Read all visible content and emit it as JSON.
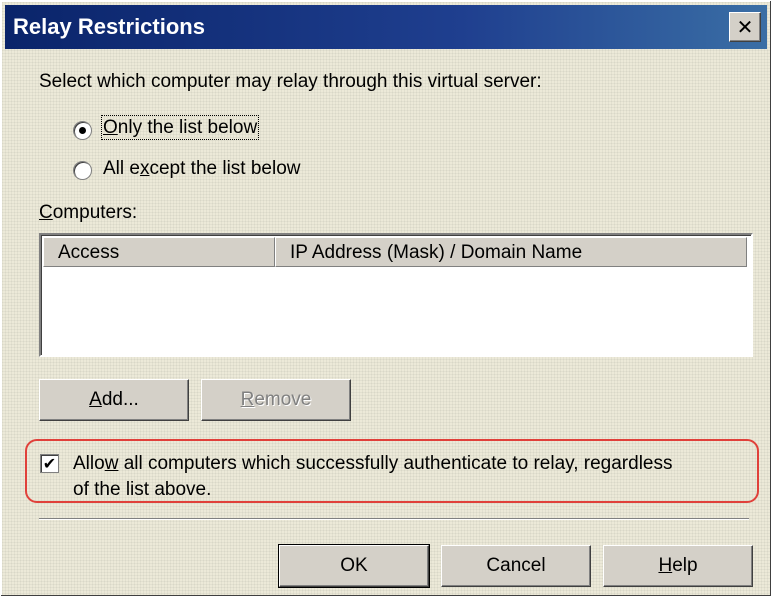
{
  "dialog": {
    "title": "Relay Restrictions",
    "close_glyph": "✕"
  },
  "prompt": "Select which computer may relay through this virtual server:",
  "radios": [
    {
      "label_prefix": "",
      "label_accel": "O",
      "label_rest": "nly the list below",
      "checked": true
    },
    {
      "label_prefix": "All e",
      "label_accel": "x",
      "label_rest": "cept the list below",
      "checked": false
    }
  ],
  "computers": {
    "label_accel": "C",
    "label_rest": "omputers:",
    "columns": [
      "Access",
      "IP Address (Mask) / Domain Name"
    ],
    "rows": []
  },
  "buttons": {
    "add": {
      "accel": "A",
      "rest": "dd..."
    },
    "remove": {
      "accel": "R",
      "rest": "emove"
    },
    "ok": "OK",
    "cancel": "Cancel",
    "help": {
      "accel": "H",
      "rest": "elp"
    }
  },
  "authenticate_checkbox": {
    "checked": true,
    "check_glyph": "✔",
    "label_prefix": "Allo",
    "label_accel": "w",
    "label_rest": " all computers which successfully authenticate to relay, regardless",
    "label_line2": "of the list above."
  },
  "colors": {
    "titlebar": "#0a246a",
    "dialog_face": "#ece9d8",
    "annotation_outline": "#e0403a"
  }
}
